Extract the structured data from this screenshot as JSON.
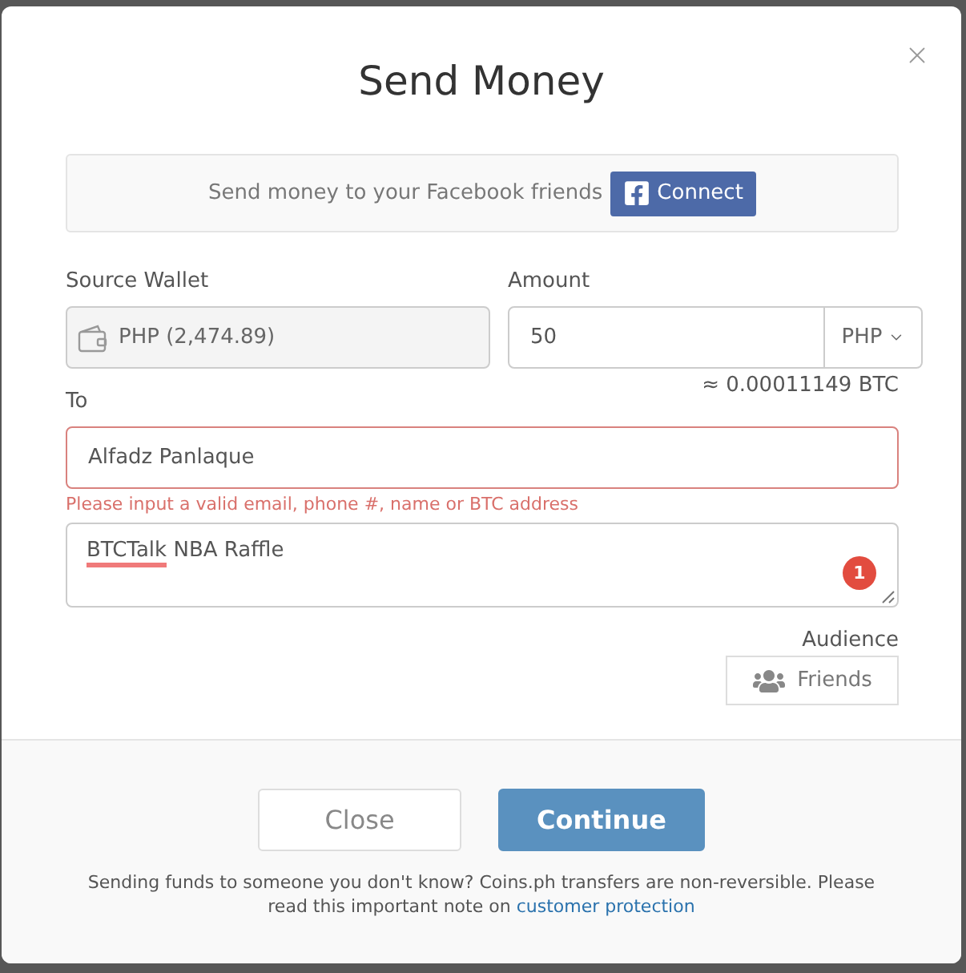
{
  "dialog": {
    "title": "Send Money"
  },
  "facebook_banner": {
    "text": "Send money to your Facebook friends",
    "button": "Connect"
  },
  "source_wallet": {
    "label": "Source Wallet",
    "value": "PHP (2,474.89)",
    "disabled": true
  },
  "amount": {
    "label": "Amount",
    "value": "50",
    "currency": "PHP",
    "conversion": "≈ 0.00011149 BTC"
  },
  "to": {
    "label": "To",
    "value": "Alfadz Panlaque",
    "invalid": true,
    "error": "Please input a valid email, phone #, name or BTC address"
  },
  "message": {
    "words": [
      {
        "text": "BTCTalk",
        "misspelled": true
      },
      {
        "text": "NBA",
        "misspelled": false
      },
      {
        "text": "Raffle",
        "misspelled": false
      }
    ],
    "badge": "1"
  },
  "audience": {
    "label": "Audience",
    "value": "Friends"
  },
  "footer": {
    "buttons": [
      {
        "label": "Close",
        "kind": "secondary"
      },
      {
        "label": "Continue",
        "kind": "primary"
      }
    ],
    "note": {
      "text": "Sending funds to someone you don't know? Coins.ph transfers are non-reversible. Please read this important note on",
      "link": "customer protection"
    }
  }
}
